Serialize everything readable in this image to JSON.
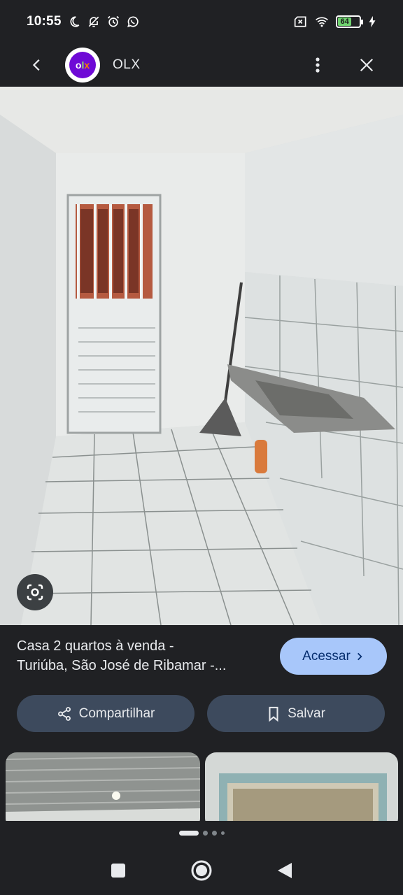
{
  "status_bar": {
    "time": "10:55",
    "battery_level": "64",
    "icons_left": [
      "moon-icon",
      "notifications-off-icon",
      "alarm-icon",
      "whatsapp-icon"
    ],
    "icons_right": [
      "sim-x-icon",
      "wifi-icon",
      "battery-icon",
      "charging-icon"
    ]
  },
  "app_bar": {
    "site_name": "OLX",
    "logo_text": "olx"
  },
  "result": {
    "title_line1": "Casa 2 quartos à venda -",
    "title_line2": "Turiúba, São José de Ribamar -...",
    "visit_label": "Acessar",
    "share_label": "Compartilhar",
    "save_label": "Salvar"
  },
  "pager": {
    "count": 4,
    "active": 0
  },
  "colors": {
    "background": "#202124",
    "visit_button": "#a8c7fa",
    "action_button": "#3d4a5d",
    "olx_purple": "#6e0ad6"
  }
}
